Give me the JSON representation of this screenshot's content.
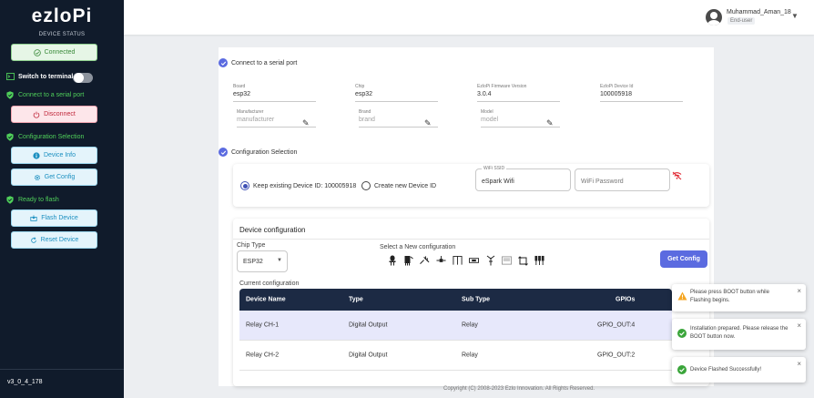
{
  "sidebar": {
    "logo": "ezloPi",
    "device_status_label": "DEVICE STATUS",
    "connected_label": "Connected",
    "switch_terminal_label": "Switch to terminal",
    "sections": {
      "serial": "Connect to a serial port",
      "config": "Configuration Selection",
      "flash": "Ready to flash"
    },
    "buttons": {
      "disconnect": "Disconnect",
      "device_info": "Device Info",
      "get_config": "Get Config",
      "flash_device": "Flash Device",
      "reset_device": "Reset Device"
    },
    "version": "v3_0_4_178"
  },
  "header": {
    "username": "Muhammad_Aman_18",
    "role": "End-user"
  },
  "serial_port": {
    "title": "Connect to a serial port",
    "fields": {
      "board": {
        "label": "Board",
        "value": "esp32"
      },
      "chip": {
        "label": "Chip",
        "value": "esp32"
      },
      "firmware": {
        "label": "EzloPi Firmware Version",
        "value": "3.0.4"
      },
      "device_id": {
        "label": "EzloPi Device Id",
        "value": "100005918"
      },
      "manufacturer": {
        "label": "Manufacturer",
        "value": "manufacturer"
      },
      "brand": {
        "label": "Brand",
        "value": "brand"
      },
      "model": {
        "label": "Model",
        "value": "model"
      }
    }
  },
  "config_selection": {
    "title": "Configuration Selection",
    "keep_existing": "Keep existing Device ID: 100005918",
    "create_new": "Create new Device ID",
    "wifi_ssid_label": "WiFi SSID",
    "wifi_ssid_value": "eSpark Wifi",
    "wifi_password_placeholder": "WiFi Password"
  },
  "device_configuration": {
    "title": "Device configuration",
    "chip_type_label": "Chip Type",
    "chip_type_value": "ESP32",
    "new_config_label": "Select a New configuration",
    "get_config_button": "Get Config",
    "current_config_label": "Current configuration",
    "columns": [
      "Device Name",
      "Type",
      "Sub Type",
      "GPIOs"
    ],
    "rows": [
      [
        "Relay CH-1",
        "Digital Output",
        "Relay",
        "GPIO_OUT:4"
      ],
      [
        "Relay CH-2",
        "Digital Output",
        "Relay",
        "GPIO_OUT:2"
      ]
    ]
  },
  "footer": "Copyright (C) 2008-2023 Ezlo Innovation. All Rights Reserved.",
  "toasts": [
    {
      "type": "warning",
      "message": "Please press BOOT button while Flashing begins."
    },
    {
      "type": "success",
      "message": "Installation prepared. Please release the BOOT button now."
    },
    {
      "type": "success",
      "message": "Device Flashed Successfully!"
    }
  ],
  "colors": {
    "sidebar_bg": "#101b2b",
    "accent": "#5b6be0",
    "success": "#3aa53a",
    "warning": "#f5a623",
    "table_header": "#1c2a44"
  }
}
